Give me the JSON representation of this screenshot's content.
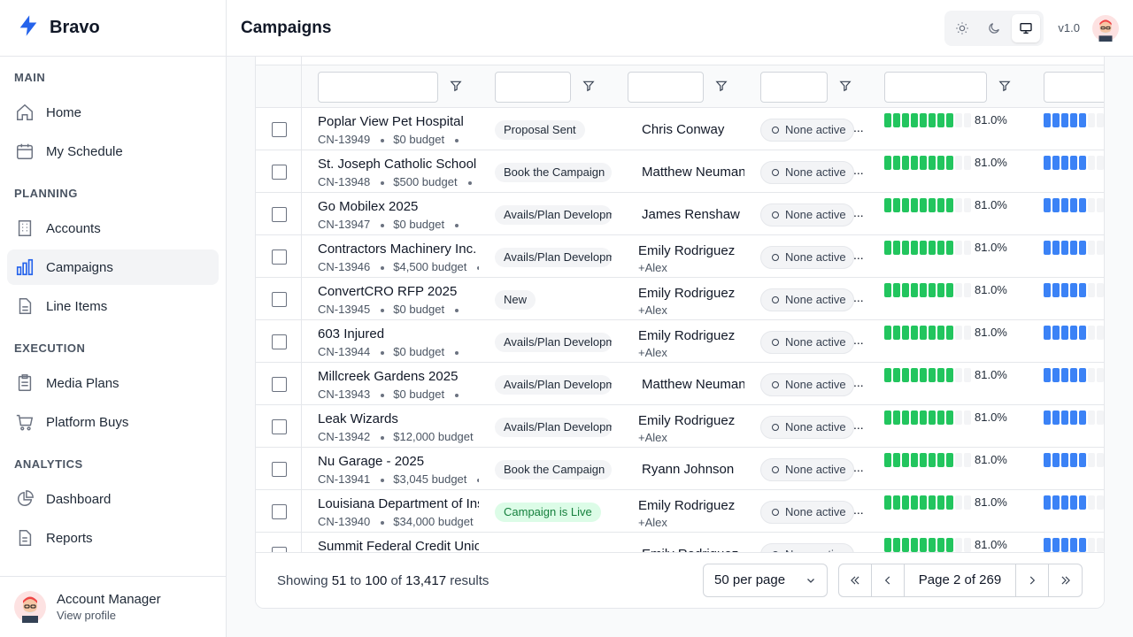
{
  "app": {
    "name": "Bravo",
    "version": "v1.0"
  },
  "header": {
    "title": "Campaigns"
  },
  "theme": {
    "options": [
      "light",
      "dark",
      "system"
    ],
    "selected": "system"
  },
  "sidebar": {
    "sections": [
      {
        "title": "MAIN",
        "items": [
          {
            "label": "Home",
            "icon": "home-icon"
          },
          {
            "label": "My Schedule",
            "icon": "calendar-icon"
          }
        ]
      },
      {
        "title": "PLANNING",
        "items": [
          {
            "label": "Accounts",
            "icon": "building-icon"
          },
          {
            "label": "Campaigns",
            "icon": "bar-chart-icon",
            "active": true
          },
          {
            "label": "Line Items",
            "icon": "document-icon"
          }
        ]
      },
      {
        "title": "EXECUTION",
        "items": [
          {
            "label": "Media Plans",
            "icon": "clipboard-icon"
          },
          {
            "label": "Platform Buys",
            "icon": "cart-icon"
          }
        ]
      },
      {
        "title": "ANALYTICS",
        "items": [
          {
            "label": "Dashboard",
            "icon": "pie-chart-icon"
          },
          {
            "label": "Reports",
            "icon": "report-icon"
          }
        ]
      }
    ]
  },
  "account": {
    "name": "Account Manager",
    "link": "View profile"
  },
  "rows": [
    {
      "name": "Poplar View Pet Hospital",
      "id": "CN-13949",
      "budget": "$0 budget",
      "status": "Proposal Sent",
      "owner": "Chris Conway",
      "owner_extra": "",
      "active": "None active",
      "progress": "81.0%"
    },
    {
      "name": "St. Joseph Catholic School",
      "id": "CN-13948",
      "budget": "$500 budget",
      "status": "Book the Campaign",
      "owner": "Matthew Neumann",
      "owner_extra": "",
      "active": "None active",
      "progress": "81.0%"
    },
    {
      "name": "Go Mobilex 2025",
      "id": "CN-13947",
      "budget": "$0 budget",
      "status": "Avails/Plan Development",
      "owner": "James Renshaw",
      "owner_extra": "",
      "active": "None active",
      "progress": "81.0%"
    },
    {
      "name": "Contractors Machinery Inc.",
      "id": "CN-13946",
      "budget": "$4,500 budget",
      "status": "Avails/Plan Development",
      "owner": "Emily Rodriguez",
      "owner_extra": "+Alex",
      "active": "None active",
      "progress": "81.0%"
    },
    {
      "name": "ConvertCRO RFP 2025",
      "id": "CN-13945",
      "budget": "$0 budget",
      "status": "New",
      "owner": "Emily Rodriguez",
      "owner_extra": "+Alex",
      "active": "None active",
      "progress": "81.0%"
    },
    {
      "name": "603 Injured",
      "id": "CN-13944",
      "budget": "$0 budget",
      "status": "Avails/Plan Development",
      "owner": "Emily Rodriguez",
      "owner_extra": "+Alex",
      "active": "None active",
      "progress": "81.0%"
    },
    {
      "name": "Millcreek Gardens 2025",
      "id": "CN-13943",
      "budget": "$0 budget",
      "status": "Avails/Plan Development",
      "owner": "Matthew Neumann",
      "owner_extra": "",
      "active": "None active",
      "progress": "81.0%"
    },
    {
      "name": "Leak Wizards",
      "id": "CN-13942",
      "budget": "$12,000 budget",
      "status": "Avails/Plan Development",
      "owner": "Emily Rodriguez",
      "owner_extra": "+Alex",
      "active": "None active",
      "progress": "81.0%"
    },
    {
      "name": "Nu Garage - 2025",
      "id": "CN-13941",
      "budget": "$3,045 budget",
      "status": "Book the Campaign",
      "owner": "Ryann Johnson",
      "owner_extra": "",
      "active": "None active",
      "progress": "81.0%"
    },
    {
      "name": "Louisiana Department of Insurance",
      "id": "CN-13940",
      "budget": "$34,000 budget",
      "status": "Campaign is Live",
      "owner": "Emily Rodriguez",
      "owner_extra": "+Alex",
      "active": "None active",
      "progress": "81.0%"
    },
    {
      "name": "Summit Federal Credit Union",
      "id": "",
      "budget": "",
      "status": "",
      "owner": "Emily Rodriguez",
      "owner_extra": "",
      "active": "None active",
      "progress": "81.0%"
    }
  ],
  "footer": {
    "showing_prefix": "Showing",
    "from": "51",
    "to_word": "to",
    "to": "100",
    "of_word": "of",
    "total": "13,417",
    "suffix": "results",
    "per_page": "50 per page",
    "page_label": "Page 2 of 269"
  },
  "colors": {
    "accent": "#2563eb",
    "progress_green": "#22c55e",
    "progress_blue": "#3b82f6",
    "live_badge": "#dcfce7"
  }
}
